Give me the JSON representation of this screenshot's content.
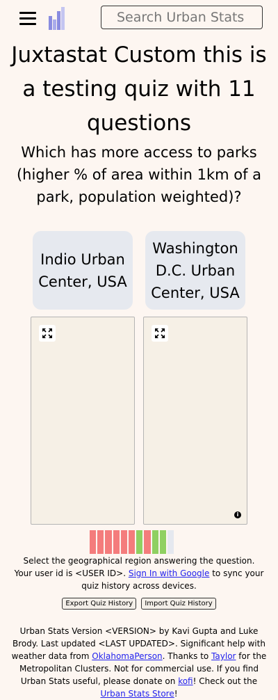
{
  "header": {
    "search_placeholder": "Search Urban Stats"
  },
  "quiz": {
    "title": "Juxtastat Custom this is a testing quiz with 11 questions",
    "question": "Which has more access to parks (higher % of area within 1km of a park, population weighted)?",
    "choice_a": "Indio Urban Center, USA",
    "choice_b": "Washington D.C. Urban Center, USA",
    "progress": [
      "wrong",
      "wrong",
      "wrong",
      "wrong",
      "wrong",
      "wrong",
      "correct",
      "wrong",
      "correct",
      "correct",
      "pending"
    ],
    "progress_colors": {
      "wrong": "#f47c7c",
      "correct": "#8fd061",
      "pending": "#e5e8ef"
    }
  },
  "status": {
    "instruction": "Select the geographical region answering the question.",
    "user_id_prefix": "Your user id is ",
    "user_id": "<USER ID>",
    "user_id_suffix": ". ",
    "sign_in_link": "Sign In with Google",
    "sync_text": " to sync your quiz history across devices."
  },
  "buttons": {
    "export": "Export Quiz History",
    "import": "Import Quiz History"
  },
  "footer": {
    "t1": "Urban Stats Version ",
    "version": "<VERSION>",
    "t2": " by Kavi Gupta and Luke Brody. Last updated ",
    "last_updated": "<LAST UPDATED>",
    "t3": ". Significant help with weather data from ",
    "link_oklahoma": "OklahomaPerson",
    "t4": ". Thanks to ",
    "link_taylor": "Taylor",
    "t5": " for the Metropolitan Clusters. Not for commercial use. If you find Urban Stats useful, please donate on ",
    "link_kofi": "kofi",
    "t6": "! Check out the ",
    "link_store": "Urban Stats Store",
    "t7": "!"
  },
  "colors": {
    "background": "#fdf6f1",
    "choice_bg": "#e6e9ef",
    "map_bg": "#f6f0e6",
    "link": "#2222ee",
    "logo": "#8a8ce0"
  },
  "icons": {
    "menu": "hamburger-menu-icon",
    "logo": "urban-stats-logo",
    "expand": "expand-arrows-icon",
    "info": "info-icon"
  }
}
